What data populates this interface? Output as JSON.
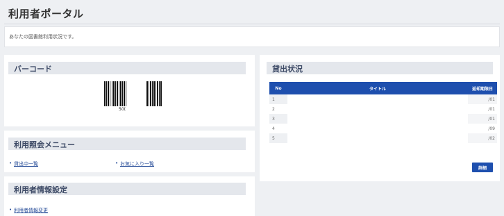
{
  "page": {
    "title": "利用者ポータル",
    "notice": "あなたの図書館利用状況です。"
  },
  "barcode_panel": {
    "heading": "バーコード",
    "number": "50("
  },
  "menu_panel": {
    "heading": "利用照会メニュー",
    "links": [
      "貸出中一覧",
      "お気に入り一覧"
    ]
  },
  "settings_panel": {
    "heading": "利用者情報設定",
    "links": [
      "利用者情報変更"
    ]
  },
  "loan_panel": {
    "heading": "貸出状況",
    "columns": [
      "No",
      "タイトル",
      "返却期限日"
    ],
    "rows": [
      {
        "no": "1",
        "title": "",
        "due": "/01"
      },
      {
        "no": "2",
        "title": "",
        "due": "/01"
      },
      {
        "no": "3",
        "title": "",
        "due": "/01"
      },
      {
        "no": "4",
        "title": "",
        "due": "/09"
      },
      {
        "no": "5",
        "title": "",
        "due": "/02"
      }
    ],
    "detail_button": "詳細"
  }
}
